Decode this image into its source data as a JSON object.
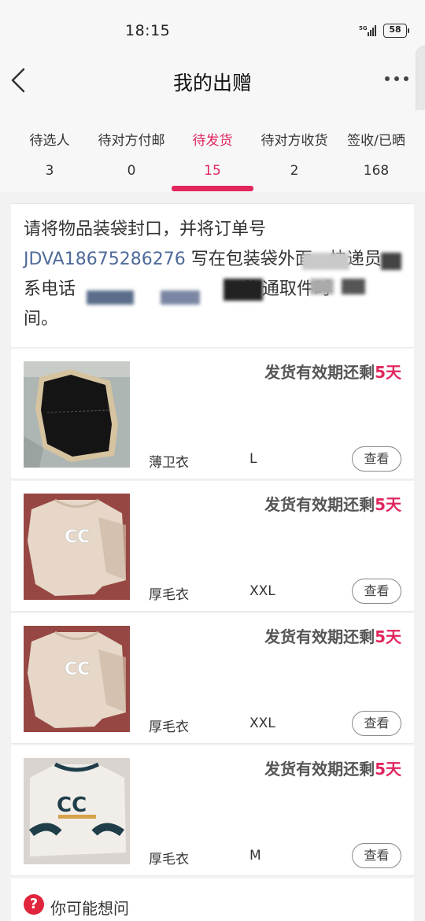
{
  "status": {
    "time": "18:15",
    "network": "5G",
    "battery": "58"
  },
  "header": {
    "title": "我的出赠",
    "back_icon": "chevron-left-icon",
    "more_icon": "more-dots-icon"
  },
  "tabs": [
    {
      "label": "待选人",
      "count": "3",
      "active": false
    },
    {
      "label": "待对方付邮",
      "count": "0",
      "active": false
    },
    {
      "label": "待发货",
      "count": "15",
      "active": true
    },
    {
      "label": "待对方收货",
      "count": "2",
      "active": false
    },
    {
      "label": "签收/已晒",
      "count": "168",
      "active": false
    }
  ],
  "instruction": {
    "prefix": "请将物品装袋封口，并将订单号 ",
    "order_no": "JDVA18675286276",
    "suffix": " 写在包装袋外面。快递员",
    "line3": "系电话",
    "line3_end": "沟通取件时",
    "line4": "间。"
  },
  "items": [
    {
      "deadline_prefix": "发货有效期还剩",
      "deadline_days": "5天",
      "name": "薄卫衣",
      "size": "L",
      "button": "查看",
      "image": "black-vest"
    },
    {
      "deadline_prefix": "发货有效期还剩",
      "deadline_days": "5天",
      "name": "厚毛衣",
      "size": "XXL",
      "button": "查看",
      "image": "beige-sweater"
    },
    {
      "deadline_prefix": "发货有效期还剩",
      "deadline_days": "5天",
      "name": "厚毛衣",
      "size": "XXL",
      "button": "查看",
      "image": "beige-sweater"
    },
    {
      "deadline_prefix": "发货有效期还剩",
      "deadline_days": "5天",
      "name": "厚毛衣",
      "size": "M",
      "button": "查看",
      "image": "white-sweater"
    }
  ],
  "faq": {
    "icon": "question-icon",
    "label": "你可能想问"
  },
  "colors": {
    "accent": "#e0265d",
    "link": "#4f6a9a",
    "faq_icon": "#e0243b"
  }
}
